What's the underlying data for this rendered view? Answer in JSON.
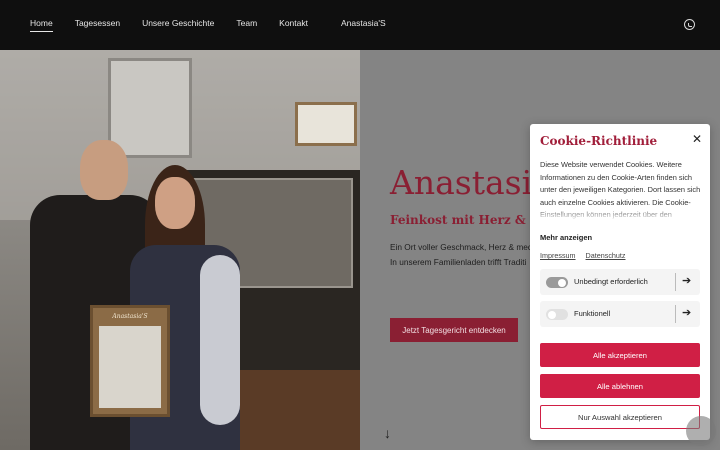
{
  "header": {
    "nav": [
      "Home",
      "Tagesessen",
      "Unsere Geschichte",
      "Team",
      "Kontakt"
    ],
    "brand": "Anastasia'S",
    "whatsapp_icon": "whatsapp-icon"
  },
  "hero": {
    "photo_sign": "Anastasia'S",
    "title": "Anastasia",
    "subtitle": "Feinkost mit Herz & Seele",
    "text_line1": "Ein Ort voller Geschmack, Herz & mediterraner",
    "text_line2": "In unserem Familienladen trifft Traditi",
    "cta": "Jetzt Tagesgericht entdecken",
    "arrow": "↓"
  },
  "cookie": {
    "title": "Cookie-Richtlinie",
    "close": "✕",
    "text": "Diese Website verwendet Cookies. Weitere Informationen zu den Cookie-Arten finden sich unter den jeweiligen Kategorien. Dort lassen sich auch einzelne Cookies aktivieren. Die Cookie-Einstellungen können jederzeit über den",
    "more": "Mehr anzeigen",
    "link_impressum": "Impressum",
    "link_datenschutz": "Datenschutz",
    "category1": "Unbedingt erforderlich",
    "category2": "Funktionell",
    "arrow": "➔",
    "accept_all": "Alle akzeptieren",
    "reject_all": "Alle ablehnen",
    "accept_selection": "Nur Auswahl akzeptieren"
  },
  "colors": {
    "accent": "#8a1f33",
    "button": "#d01f45",
    "header": "#0f0f0f"
  }
}
